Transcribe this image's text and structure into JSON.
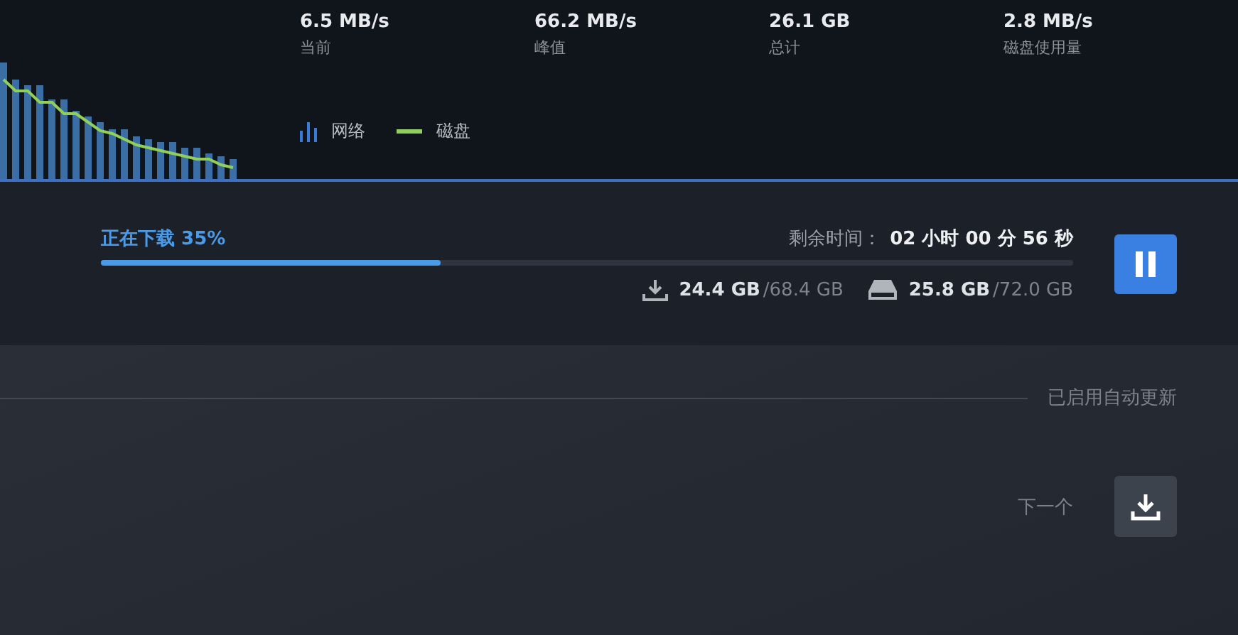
{
  "stats": [
    {
      "value": "6.5 MB/s",
      "label": "当前"
    },
    {
      "value": "66.2 MB/s",
      "label": "峰值"
    },
    {
      "value": "26.1 GB",
      "label": "总计"
    },
    {
      "value": "2.8 MB/s",
      "label": "磁盘使用量"
    }
  ],
  "legend": [
    {
      "kind": "bars",
      "label": "网络"
    },
    {
      "kind": "line",
      "label": "磁盘"
    }
  ],
  "download": {
    "status": "正在下载",
    "percent": "35%",
    "level": 0.35,
    "time_label": "剩余时间：",
    "time_value": "02 小时 00 分 56 秒",
    "downloaded": "24.4 GB",
    "download_total": "/68.4 GB",
    "disk_used": "25.8 GB",
    "disk_total": "/72.0 GB"
  },
  "auto_update": "已启用自动更新",
  "next_label": "下一个"
}
